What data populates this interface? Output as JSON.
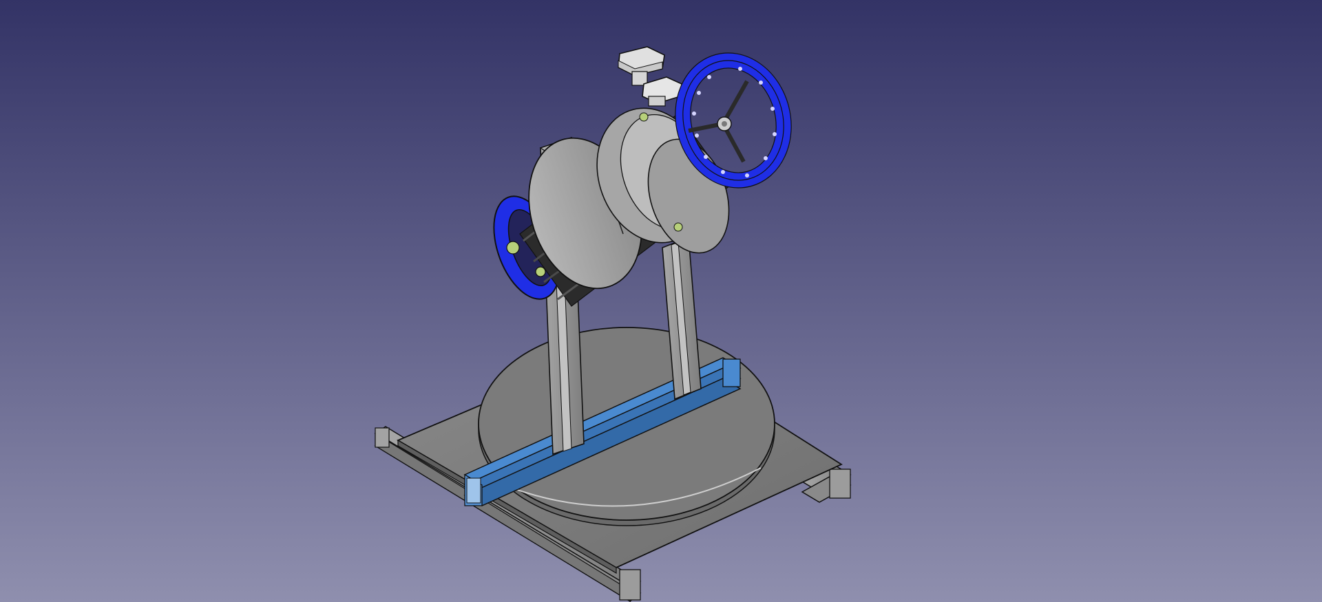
{
  "viewport": {
    "background_top": "#333366",
    "background_bottom": "#8f8fae"
  },
  "model": {
    "colors": {
      "frame_grey": "#9a9a9a",
      "plate_grey": "#7d7d7d",
      "highlight_blue": "#3f7fc4",
      "wheel_blue": "#1f2ee6",
      "edge": "#111111",
      "nut_white": "#dcdcdc",
      "accent_green": "#b7d07a"
    },
    "icons": {
      "turntable": "turntable-icon",
      "handwheel": "handwheel-icon",
      "bolt": "hex-bolt-icon"
    }
  }
}
